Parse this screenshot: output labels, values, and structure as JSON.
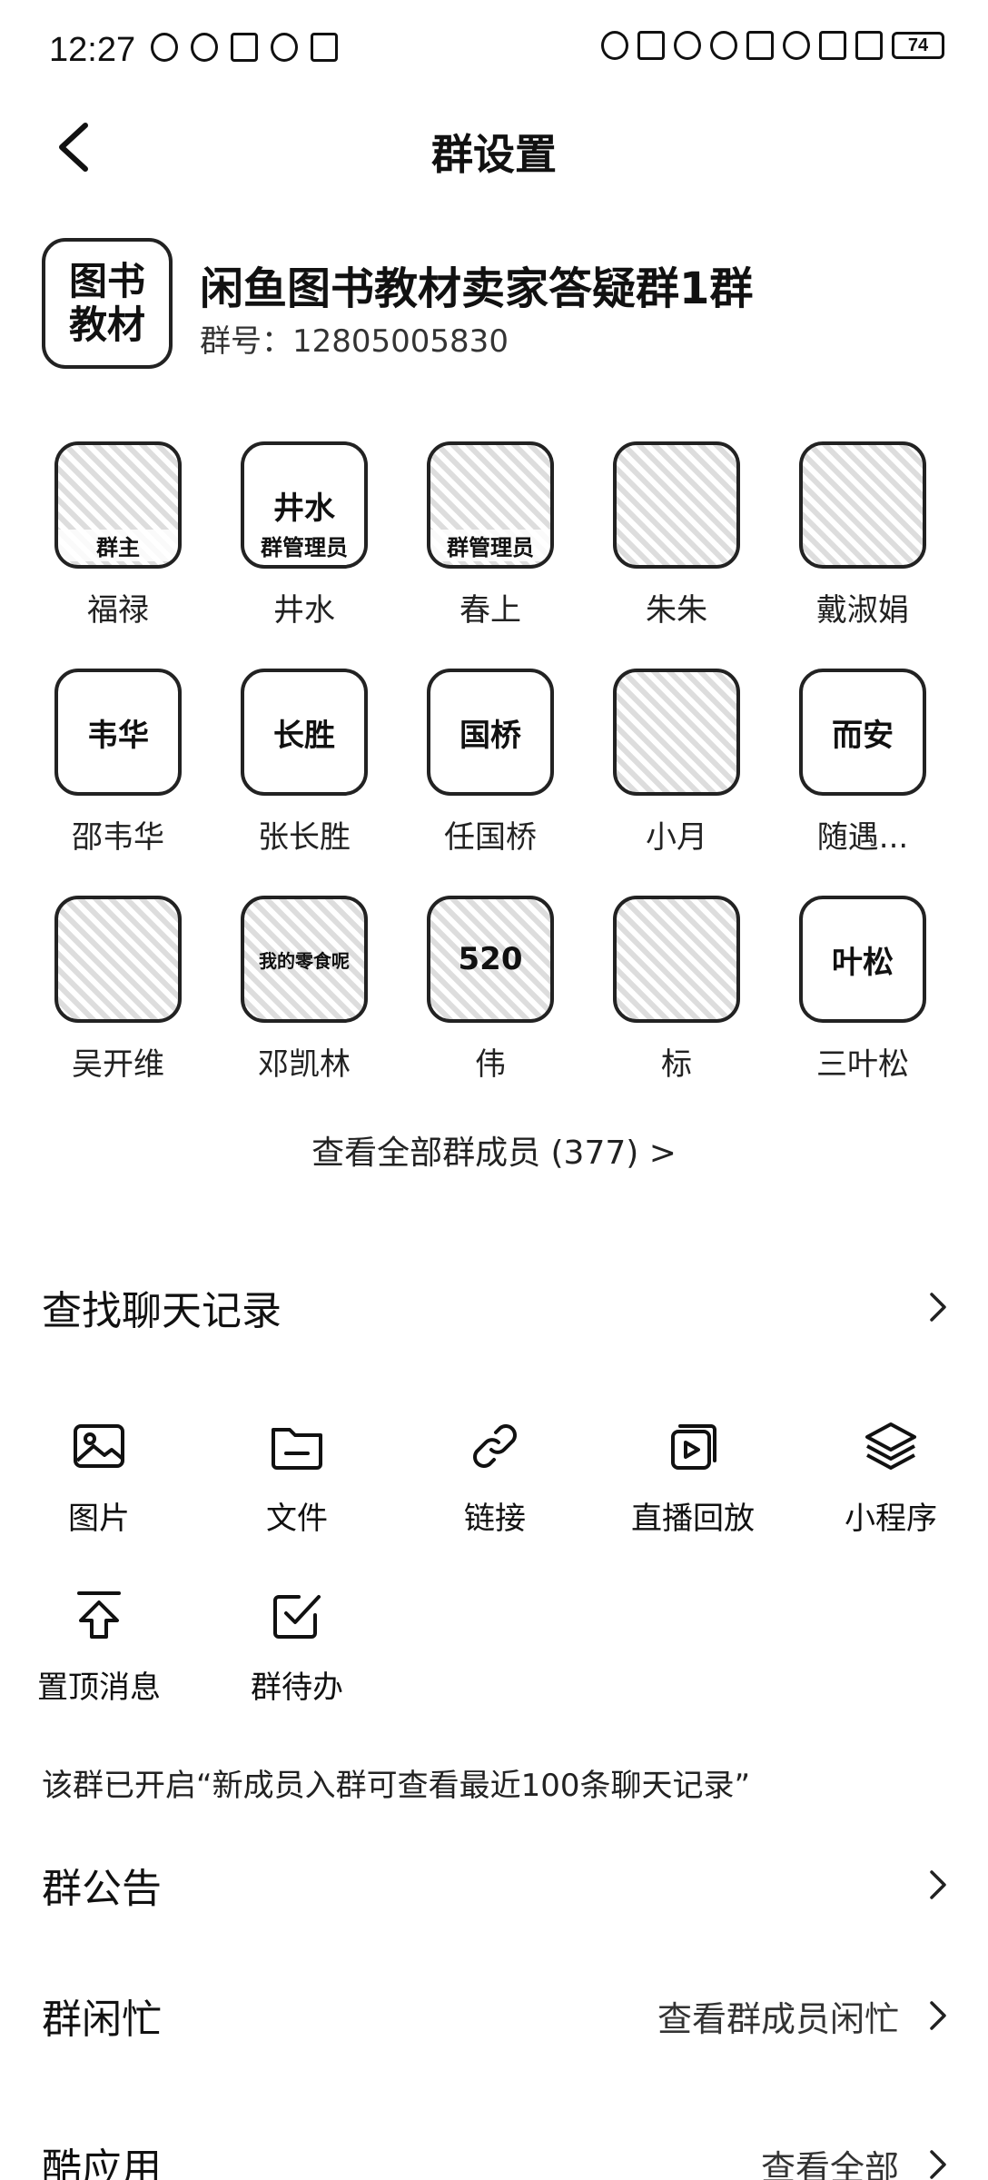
{
  "status": {
    "time": "12:27",
    "battery": "74"
  },
  "nav": {
    "title": "群设置"
  },
  "group": {
    "avatar_text": "图书\n教材",
    "name": "闲鱼图书教材卖家答疑群1群",
    "id": "群号：12805005830"
  },
  "members": [
    {
      "name": "福禄",
      "role": "群主",
      "avatar": "photo",
      "text": ""
    },
    {
      "name": "井水",
      "role": "群管理员",
      "avatar": "text",
      "text": "井水"
    },
    {
      "name": "春上",
      "role": "群管理员",
      "avatar": "photo",
      "text": ""
    },
    {
      "name": "朱朱",
      "role": "",
      "avatar": "photo",
      "text": ""
    },
    {
      "name": "戴淑娟",
      "role": "",
      "avatar": "photo",
      "text": ""
    },
    {
      "name": "邵韦华",
      "role": "",
      "avatar": "text",
      "text": "韦华"
    },
    {
      "name": "张长胜",
      "role": "",
      "avatar": "text",
      "text": "长胜"
    },
    {
      "name": "任国桥",
      "role": "",
      "avatar": "text",
      "text": "国桥"
    },
    {
      "name": "小月",
      "role": "",
      "avatar": "photo",
      "text": ""
    },
    {
      "name": "随遇...",
      "role": "",
      "avatar": "text",
      "text": "而安"
    },
    {
      "name": "吴开维",
      "role": "",
      "avatar": "photo",
      "text": ""
    },
    {
      "name": "邓凯林",
      "role": "",
      "avatar": "photo",
      "text": "我的零食呢"
    },
    {
      "name": "伟",
      "role": "",
      "avatar": "photo",
      "text": "520"
    },
    {
      "name": "标",
      "role": "",
      "avatar": "photo",
      "text": ""
    },
    {
      "name": "三叶松",
      "role": "",
      "avatar": "text",
      "text": "叶松"
    }
  ],
  "view_all": "查看全部群成员 (377) >",
  "search_history": {
    "label": "查找聊天记录"
  },
  "tools": [
    {
      "label": "图片",
      "icon": "image-icon"
    },
    {
      "label": "文件",
      "icon": "folder-icon"
    },
    {
      "label": "链接",
      "icon": "link-icon"
    },
    {
      "label": "直播回放",
      "icon": "replay-icon"
    },
    {
      "label": "小程序",
      "icon": "layers-icon"
    },
    {
      "label": "置顶消息",
      "icon": "pin-top-icon"
    },
    {
      "label": "群待办",
      "icon": "todo-check-icon"
    }
  ],
  "notice": "该群已开启“新成员入群可查看最近100条聊天记录”",
  "announcement": {
    "label": "群公告"
  },
  "busy": {
    "label": "群闲忙",
    "right": "查看群成员闲忙"
  },
  "apps": {
    "label": "酷应用",
    "right": "查看全部"
  }
}
